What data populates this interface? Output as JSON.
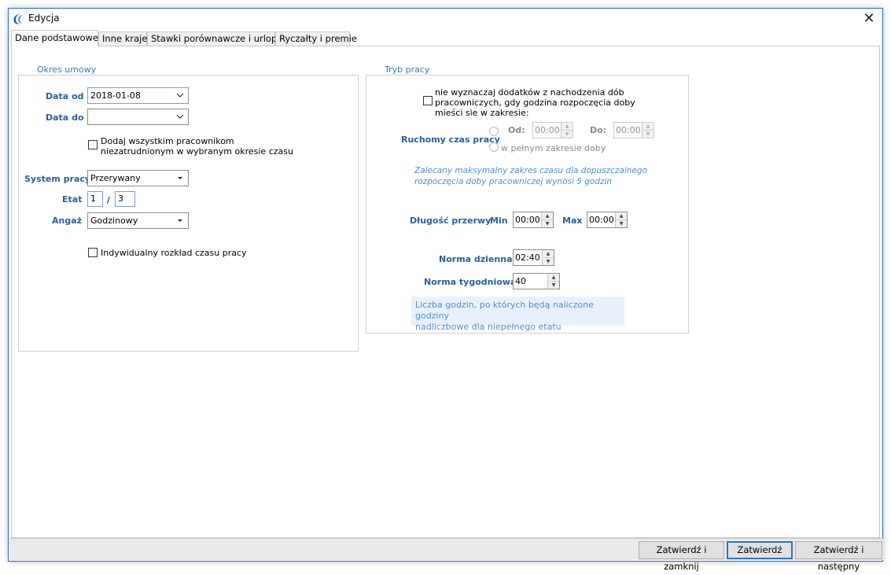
{
  "window": {
    "title": "Edycja",
    "close_glyph": "✕"
  },
  "tabs": [
    {
      "label": "Dane podstawowe",
      "active": true
    },
    {
      "label": "Inne kraje",
      "active": false
    },
    {
      "label": "Stawki porównawcze i urlopy",
      "active": false
    },
    {
      "label": "Ryczałty i premie",
      "active": false
    }
  ],
  "okres": {
    "title": "Okres umowy",
    "data_od_label": "Data od",
    "data_od_value": "2018-01-08",
    "data_do_label": "Data do",
    "data_do_value": "",
    "dodaj_line1": "Dodaj wszystkim pracownikom",
    "dodaj_line2": "niezatrudnionym w wybranym okresie czasu",
    "system_label": "System pracy",
    "system_value": "Przerywany",
    "etat_label": "Etat",
    "etat_num": "1",
    "etat_sep": "/",
    "etat_den": "3",
    "angaz_label": "Angaż",
    "angaz_value": "Godzinowy",
    "indywidualny_label": "Indywidualny rozkład czasu pracy"
  },
  "tryb": {
    "title": "Tryb pracy",
    "niewyznaczaj_line1": "nie wyznaczaj dodatków z nachodzenia dób",
    "niewyznaczaj_line2": "pracowniczych, gdy godzina rozpoczęcia doby",
    "niewyznaczaj_line3": "mieści sie w zakresie:",
    "ruchomy_label": "Ruchomy czas pracy",
    "od_label": "Od:",
    "od_value": "00:00",
    "do_label": "Do:",
    "do_value": "00:00",
    "pelny_label": "w pełnym zakresie doby",
    "zalecany_line1": "Zalecany maksymalny zakres czasu dla dopuszczalnego",
    "zalecany_line2": "rozpoczęcia doby pracowniczej wynosi 5 godzin",
    "dlugosc_label": "Długość przerwy",
    "min_label": "Min",
    "min_value": "00:00",
    "max_label": "Max",
    "max_value": "00:00",
    "norma_dzienna_label": "Norma dzienna",
    "norma_dzienna_value": "02:40",
    "norma_tyg_label": "Norma tygodniowa",
    "norma_tyg_value": "40",
    "liczba_line1": "Liczba godzin, po których będą naliczone godziny",
    "liczba_line2": "nadliczbowe dla niepełnego etatu"
  },
  "footer": {
    "zatwierdz_zamknij": "Zatwierdź i zamknij",
    "zatwierdz": "Zatwierdź",
    "zatwierdz_nastepny": "Zatwierdź i następny"
  },
  "colors": {
    "label_blue": "#2a5f97",
    "group_title": "#3c78b4",
    "info_blue": "#4f8fd0",
    "focus_border": "#2f72c4"
  }
}
